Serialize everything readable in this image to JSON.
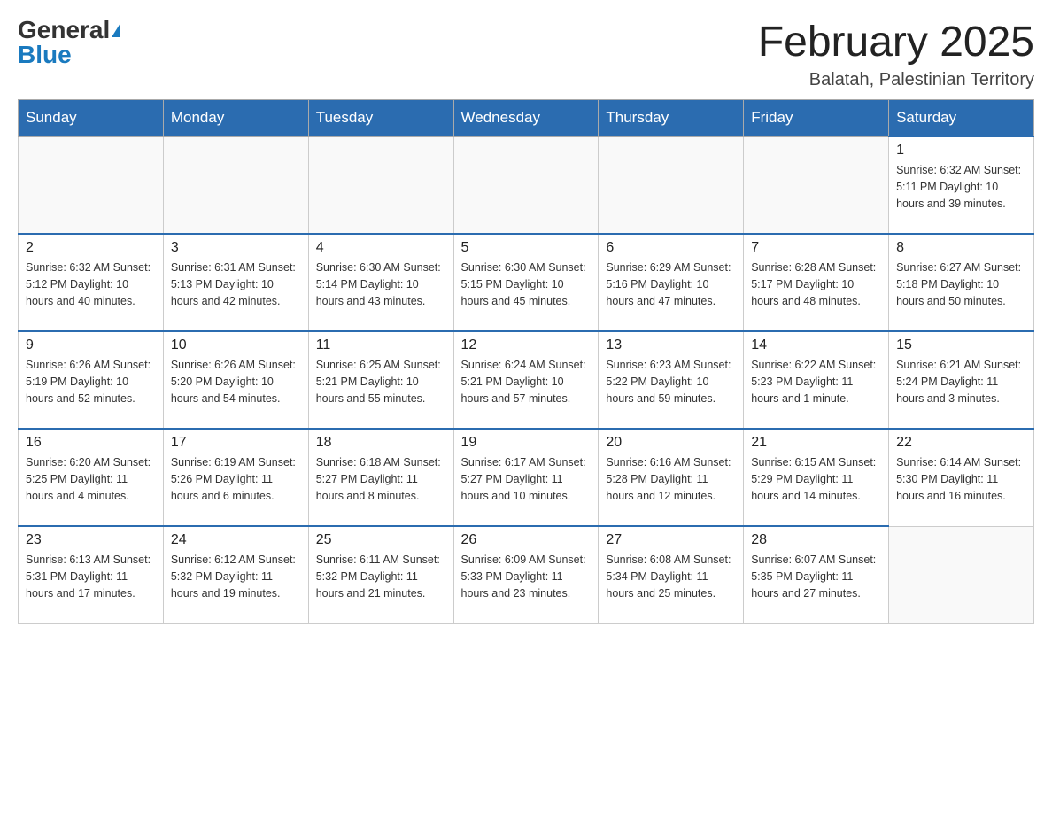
{
  "header": {
    "logo_general": "General",
    "logo_blue": "Blue",
    "title": "February 2025",
    "subtitle": "Balatah, Palestinian Territory"
  },
  "days_of_week": [
    "Sunday",
    "Monday",
    "Tuesday",
    "Wednesday",
    "Thursday",
    "Friday",
    "Saturday"
  ],
  "weeks": [
    [
      {
        "day": "",
        "info": ""
      },
      {
        "day": "",
        "info": ""
      },
      {
        "day": "",
        "info": ""
      },
      {
        "day": "",
        "info": ""
      },
      {
        "day": "",
        "info": ""
      },
      {
        "day": "",
        "info": ""
      },
      {
        "day": "1",
        "info": "Sunrise: 6:32 AM\nSunset: 5:11 PM\nDaylight: 10 hours\nand 39 minutes."
      }
    ],
    [
      {
        "day": "2",
        "info": "Sunrise: 6:32 AM\nSunset: 5:12 PM\nDaylight: 10 hours\nand 40 minutes."
      },
      {
        "day": "3",
        "info": "Sunrise: 6:31 AM\nSunset: 5:13 PM\nDaylight: 10 hours\nand 42 minutes."
      },
      {
        "day": "4",
        "info": "Sunrise: 6:30 AM\nSunset: 5:14 PM\nDaylight: 10 hours\nand 43 minutes."
      },
      {
        "day": "5",
        "info": "Sunrise: 6:30 AM\nSunset: 5:15 PM\nDaylight: 10 hours\nand 45 minutes."
      },
      {
        "day": "6",
        "info": "Sunrise: 6:29 AM\nSunset: 5:16 PM\nDaylight: 10 hours\nand 47 minutes."
      },
      {
        "day": "7",
        "info": "Sunrise: 6:28 AM\nSunset: 5:17 PM\nDaylight: 10 hours\nand 48 minutes."
      },
      {
        "day": "8",
        "info": "Sunrise: 6:27 AM\nSunset: 5:18 PM\nDaylight: 10 hours\nand 50 minutes."
      }
    ],
    [
      {
        "day": "9",
        "info": "Sunrise: 6:26 AM\nSunset: 5:19 PM\nDaylight: 10 hours\nand 52 minutes."
      },
      {
        "day": "10",
        "info": "Sunrise: 6:26 AM\nSunset: 5:20 PM\nDaylight: 10 hours\nand 54 minutes."
      },
      {
        "day": "11",
        "info": "Sunrise: 6:25 AM\nSunset: 5:21 PM\nDaylight: 10 hours\nand 55 minutes."
      },
      {
        "day": "12",
        "info": "Sunrise: 6:24 AM\nSunset: 5:21 PM\nDaylight: 10 hours\nand 57 minutes."
      },
      {
        "day": "13",
        "info": "Sunrise: 6:23 AM\nSunset: 5:22 PM\nDaylight: 10 hours\nand 59 minutes."
      },
      {
        "day": "14",
        "info": "Sunrise: 6:22 AM\nSunset: 5:23 PM\nDaylight: 11 hours\nand 1 minute."
      },
      {
        "day": "15",
        "info": "Sunrise: 6:21 AM\nSunset: 5:24 PM\nDaylight: 11 hours\nand 3 minutes."
      }
    ],
    [
      {
        "day": "16",
        "info": "Sunrise: 6:20 AM\nSunset: 5:25 PM\nDaylight: 11 hours\nand 4 minutes."
      },
      {
        "day": "17",
        "info": "Sunrise: 6:19 AM\nSunset: 5:26 PM\nDaylight: 11 hours\nand 6 minutes."
      },
      {
        "day": "18",
        "info": "Sunrise: 6:18 AM\nSunset: 5:27 PM\nDaylight: 11 hours\nand 8 minutes."
      },
      {
        "day": "19",
        "info": "Sunrise: 6:17 AM\nSunset: 5:27 PM\nDaylight: 11 hours\nand 10 minutes."
      },
      {
        "day": "20",
        "info": "Sunrise: 6:16 AM\nSunset: 5:28 PM\nDaylight: 11 hours\nand 12 minutes."
      },
      {
        "day": "21",
        "info": "Sunrise: 6:15 AM\nSunset: 5:29 PM\nDaylight: 11 hours\nand 14 minutes."
      },
      {
        "day": "22",
        "info": "Sunrise: 6:14 AM\nSunset: 5:30 PM\nDaylight: 11 hours\nand 16 minutes."
      }
    ],
    [
      {
        "day": "23",
        "info": "Sunrise: 6:13 AM\nSunset: 5:31 PM\nDaylight: 11 hours\nand 17 minutes."
      },
      {
        "day": "24",
        "info": "Sunrise: 6:12 AM\nSunset: 5:32 PM\nDaylight: 11 hours\nand 19 minutes."
      },
      {
        "day": "25",
        "info": "Sunrise: 6:11 AM\nSunset: 5:32 PM\nDaylight: 11 hours\nand 21 minutes."
      },
      {
        "day": "26",
        "info": "Sunrise: 6:09 AM\nSunset: 5:33 PM\nDaylight: 11 hours\nand 23 minutes."
      },
      {
        "day": "27",
        "info": "Sunrise: 6:08 AM\nSunset: 5:34 PM\nDaylight: 11 hours\nand 25 minutes."
      },
      {
        "day": "28",
        "info": "Sunrise: 6:07 AM\nSunset: 5:35 PM\nDaylight: 11 hours\nand 27 minutes."
      },
      {
        "day": "",
        "info": ""
      }
    ]
  ]
}
